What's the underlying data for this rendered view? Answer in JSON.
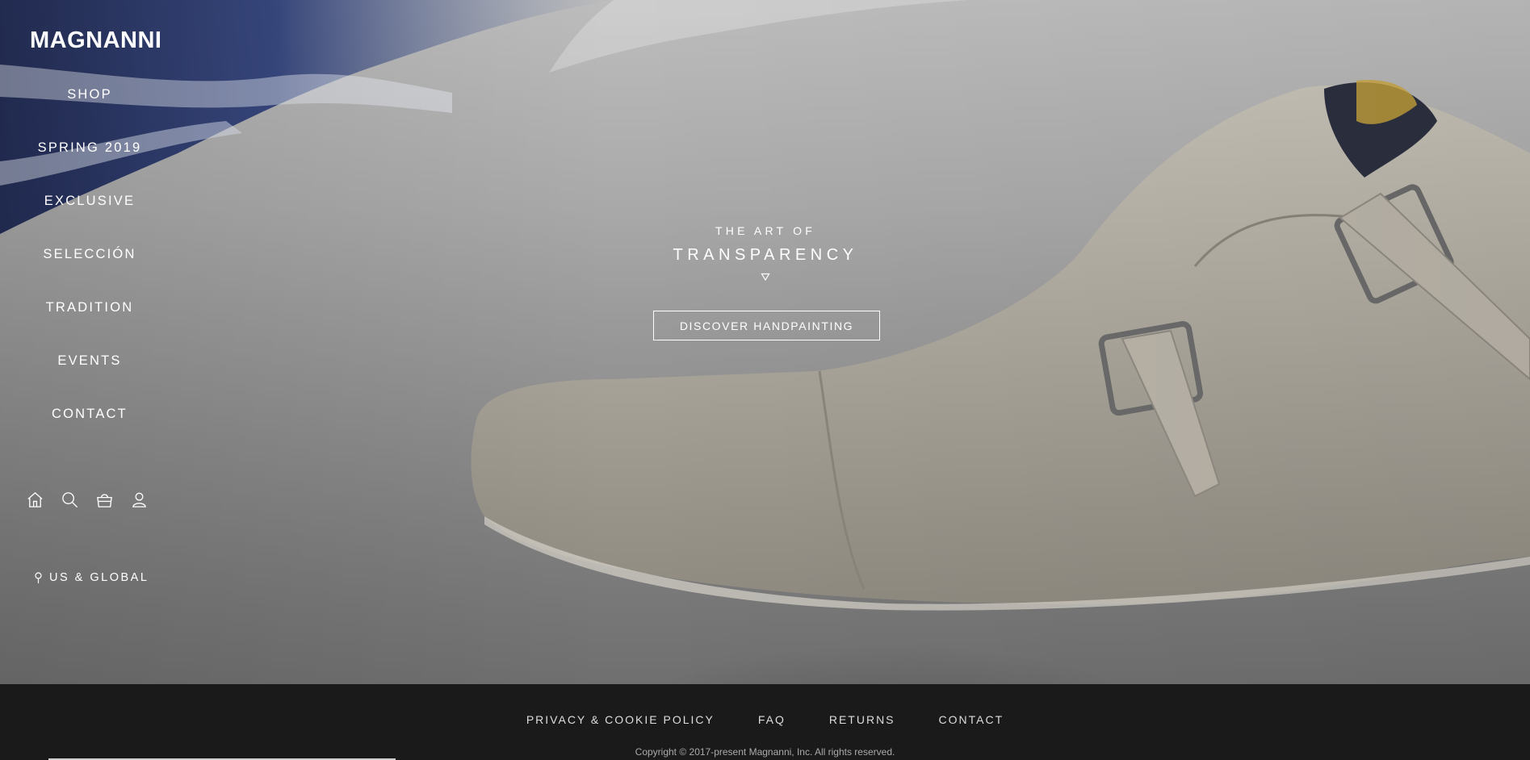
{
  "brand": {
    "logo": "MAGNANNI"
  },
  "nav": {
    "items": [
      {
        "label": "SHOP"
      },
      {
        "label": "SPRING 2019"
      },
      {
        "label": "EXCLUSIVE"
      },
      {
        "label": "SELECCIÓN"
      },
      {
        "label": "TRADITION"
      },
      {
        "label": "EVENTS"
      },
      {
        "label": "CONTACT"
      }
    ],
    "icons": [
      "home-icon",
      "search-icon",
      "bag-icon",
      "account-icon"
    ],
    "region": {
      "icon": "location-pin-icon",
      "label": "US & GLOBAL"
    }
  },
  "hero": {
    "kicker": "THE ART OF",
    "headline": "TRANSPARENCY",
    "arrow_glyph": "▿",
    "cta_label": "DISCOVER HANDPAINTING"
  },
  "footer": {
    "links": [
      {
        "label": "PRIVACY & COOKIE POLICY"
      },
      {
        "label": "FAQ"
      },
      {
        "label": "RETURNS"
      },
      {
        "label": "CONTACT"
      }
    ],
    "copyright": "Copyright © 2017-present Magnanni, Inc. All rights reserved."
  },
  "colors": {
    "footer_bg": "#1a1a1a",
    "text": "#ffffff",
    "hero_blue": "#1f2f6a",
    "shoe": "#b3aea3"
  }
}
